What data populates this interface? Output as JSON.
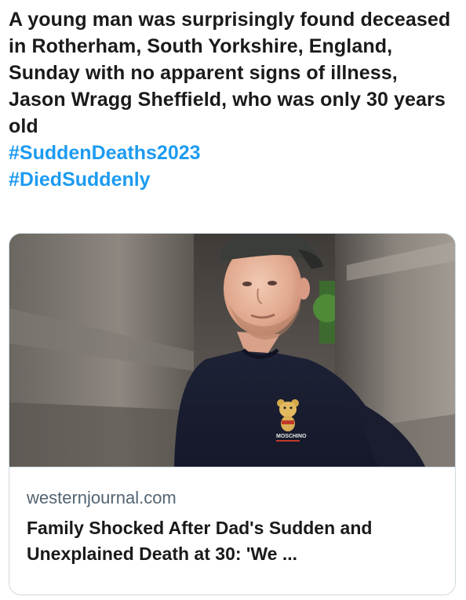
{
  "tweet": {
    "text": "A young man was surprisingly found deceased in Rotherham, South Yorkshire, England, Sunday with no apparent signs of illness, Jason Wragg Sheffield, who was only 30 years old",
    "hashtags": [
      "#SuddenDeaths2023",
      "#DiedSuddenly"
    ]
  },
  "card": {
    "image_icon": "photo-of-man-in-cap-and-navy-tshirt",
    "image_text": "MOSCHINO",
    "domain": "westernjournal.com",
    "title": "Family Shocked After Dad's Sudden and Unexplained Death at 30: 'We ..."
  },
  "colors": {
    "hashtag": "#1d9bf0",
    "text": "#1a1a1a",
    "muted": "#536471",
    "border": "#cfd9de"
  }
}
